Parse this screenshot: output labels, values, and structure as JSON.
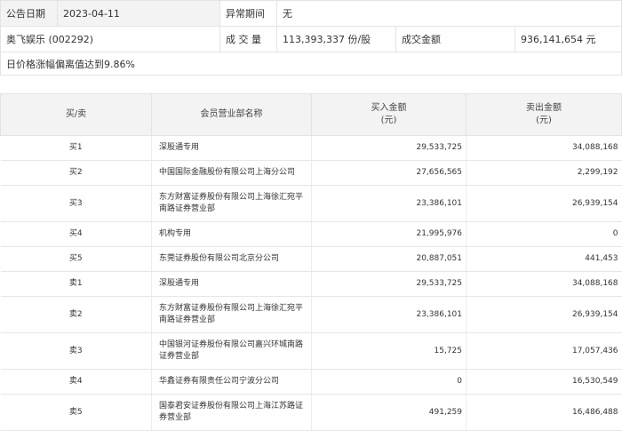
{
  "info": {
    "date_label": "公告日期",
    "date_value": "2023-04-11",
    "period_label": "异常期间",
    "period_value": "无",
    "stock_name": "奥飞娱乐 (002292)",
    "volume_label": "成 交 量",
    "volume_value": "113,393,337 份/股",
    "amount_label": "成交金额",
    "amount_value": "936,141,654 元",
    "reason": "日价格涨幅偏离值达到9.86%"
  },
  "table": {
    "headers": [
      "买/卖",
      "会员营业部名称",
      "买入金额\n(元)",
      "卖出金额\n(元)"
    ],
    "rows": [
      {
        "side": "买1",
        "dept": "深股通专用",
        "buy": "29,533,725",
        "sell": "34,088,168",
        "tall": false
      },
      {
        "side": "买2",
        "dept": "中国国际金融股份有限公司上海分公司",
        "buy": "27,656,565",
        "sell": "2,299,192",
        "tall": false
      },
      {
        "side": "买3",
        "dept": "东方财富证券股份有限公司上海徐汇宛平南路证券营业部",
        "buy": "23,386,101",
        "sell": "26,939,154",
        "tall": true
      },
      {
        "side": "买4",
        "dept": "机构专用",
        "buy": "21,995,976",
        "sell": "0",
        "tall": false
      },
      {
        "side": "买5",
        "dept": "东莞证券股份有限公司北京分公司",
        "buy": "20,887,051",
        "sell": "441,453",
        "tall": false
      },
      {
        "side": "卖1",
        "dept": "深股通专用",
        "buy": "29,533,725",
        "sell": "34,088,168",
        "tall": false
      },
      {
        "side": "卖2",
        "dept": "东方财富证券股份有限公司上海徐汇宛平南路证券营业部",
        "buy": "23,386,101",
        "sell": "26,939,154",
        "tall": true
      },
      {
        "side": "卖3",
        "dept": "中国银河证券股份有限公司嘉兴环城南路证券营业部",
        "buy": "15,725",
        "sell": "17,057,436",
        "tall": true
      },
      {
        "side": "卖4",
        "dept": "华鑫证券有限责任公司宁波分公司",
        "buy": "0",
        "sell": "16,530,549",
        "tall": false
      },
      {
        "side": "卖5",
        "dept": "国泰君安证券股份有限公司上海江苏路证券营业部",
        "buy": "491,259",
        "sell": "16,486,488",
        "tall": true
      }
    ]
  }
}
